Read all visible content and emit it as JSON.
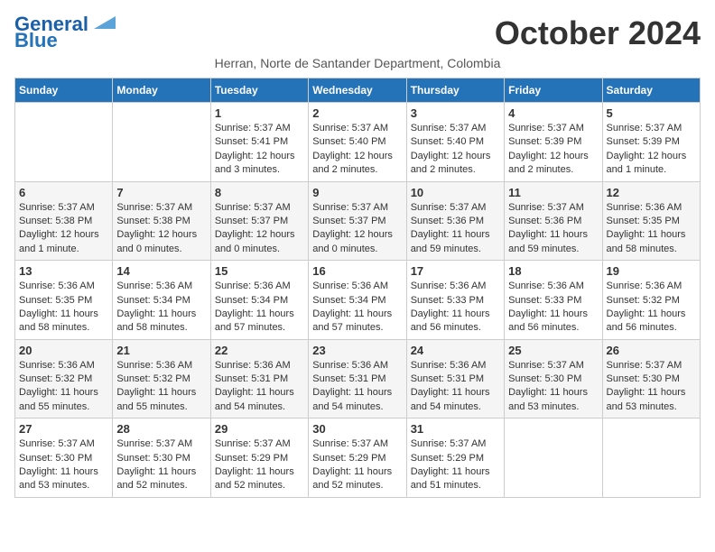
{
  "logo": {
    "line1": "General",
    "line2": "Blue"
  },
  "title": "October 2024",
  "location": "Herran, Norte de Santander Department, Colombia",
  "days_header": [
    "Sunday",
    "Monday",
    "Tuesday",
    "Wednesday",
    "Thursday",
    "Friday",
    "Saturday"
  ],
  "weeks": [
    [
      {
        "day": "",
        "info": ""
      },
      {
        "day": "",
        "info": ""
      },
      {
        "day": "1",
        "info": "Sunrise: 5:37 AM\nSunset: 5:41 PM\nDaylight: 12 hours and 3 minutes."
      },
      {
        "day": "2",
        "info": "Sunrise: 5:37 AM\nSunset: 5:40 PM\nDaylight: 12 hours and 2 minutes."
      },
      {
        "day": "3",
        "info": "Sunrise: 5:37 AM\nSunset: 5:40 PM\nDaylight: 12 hours and 2 minutes."
      },
      {
        "day": "4",
        "info": "Sunrise: 5:37 AM\nSunset: 5:39 PM\nDaylight: 12 hours and 2 minutes."
      },
      {
        "day": "5",
        "info": "Sunrise: 5:37 AM\nSunset: 5:39 PM\nDaylight: 12 hours and 1 minute."
      }
    ],
    [
      {
        "day": "6",
        "info": "Sunrise: 5:37 AM\nSunset: 5:38 PM\nDaylight: 12 hours and 1 minute."
      },
      {
        "day": "7",
        "info": "Sunrise: 5:37 AM\nSunset: 5:38 PM\nDaylight: 12 hours and 0 minutes."
      },
      {
        "day": "8",
        "info": "Sunrise: 5:37 AM\nSunset: 5:37 PM\nDaylight: 12 hours and 0 minutes."
      },
      {
        "day": "9",
        "info": "Sunrise: 5:37 AM\nSunset: 5:37 PM\nDaylight: 12 hours and 0 minutes."
      },
      {
        "day": "10",
        "info": "Sunrise: 5:37 AM\nSunset: 5:36 PM\nDaylight: 11 hours and 59 minutes."
      },
      {
        "day": "11",
        "info": "Sunrise: 5:37 AM\nSunset: 5:36 PM\nDaylight: 11 hours and 59 minutes."
      },
      {
        "day": "12",
        "info": "Sunrise: 5:36 AM\nSunset: 5:35 PM\nDaylight: 11 hours and 58 minutes."
      }
    ],
    [
      {
        "day": "13",
        "info": "Sunrise: 5:36 AM\nSunset: 5:35 PM\nDaylight: 11 hours and 58 minutes."
      },
      {
        "day": "14",
        "info": "Sunrise: 5:36 AM\nSunset: 5:34 PM\nDaylight: 11 hours and 58 minutes."
      },
      {
        "day": "15",
        "info": "Sunrise: 5:36 AM\nSunset: 5:34 PM\nDaylight: 11 hours and 57 minutes."
      },
      {
        "day": "16",
        "info": "Sunrise: 5:36 AM\nSunset: 5:34 PM\nDaylight: 11 hours and 57 minutes."
      },
      {
        "day": "17",
        "info": "Sunrise: 5:36 AM\nSunset: 5:33 PM\nDaylight: 11 hours and 56 minutes."
      },
      {
        "day": "18",
        "info": "Sunrise: 5:36 AM\nSunset: 5:33 PM\nDaylight: 11 hours and 56 minutes."
      },
      {
        "day": "19",
        "info": "Sunrise: 5:36 AM\nSunset: 5:32 PM\nDaylight: 11 hours and 56 minutes."
      }
    ],
    [
      {
        "day": "20",
        "info": "Sunrise: 5:36 AM\nSunset: 5:32 PM\nDaylight: 11 hours and 55 minutes."
      },
      {
        "day": "21",
        "info": "Sunrise: 5:36 AM\nSunset: 5:32 PM\nDaylight: 11 hours and 55 minutes."
      },
      {
        "day": "22",
        "info": "Sunrise: 5:36 AM\nSunset: 5:31 PM\nDaylight: 11 hours and 54 minutes."
      },
      {
        "day": "23",
        "info": "Sunrise: 5:36 AM\nSunset: 5:31 PM\nDaylight: 11 hours and 54 minutes."
      },
      {
        "day": "24",
        "info": "Sunrise: 5:36 AM\nSunset: 5:31 PM\nDaylight: 11 hours and 54 minutes."
      },
      {
        "day": "25",
        "info": "Sunrise: 5:37 AM\nSunset: 5:30 PM\nDaylight: 11 hours and 53 minutes."
      },
      {
        "day": "26",
        "info": "Sunrise: 5:37 AM\nSunset: 5:30 PM\nDaylight: 11 hours and 53 minutes."
      }
    ],
    [
      {
        "day": "27",
        "info": "Sunrise: 5:37 AM\nSunset: 5:30 PM\nDaylight: 11 hours and 53 minutes."
      },
      {
        "day": "28",
        "info": "Sunrise: 5:37 AM\nSunset: 5:30 PM\nDaylight: 11 hours and 52 minutes."
      },
      {
        "day": "29",
        "info": "Sunrise: 5:37 AM\nSunset: 5:29 PM\nDaylight: 11 hours and 52 minutes."
      },
      {
        "day": "30",
        "info": "Sunrise: 5:37 AM\nSunset: 5:29 PM\nDaylight: 11 hours and 52 minutes."
      },
      {
        "day": "31",
        "info": "Sunrise: 5:37 AM\nSunset: 5:29 PM\nDaylight: 11 hours and 51 minutes."
      },
      {
        "day": "",
        "info": ""
      },
      {
        "day": "",
        "info": ""
      }
    ]
  ]
}
